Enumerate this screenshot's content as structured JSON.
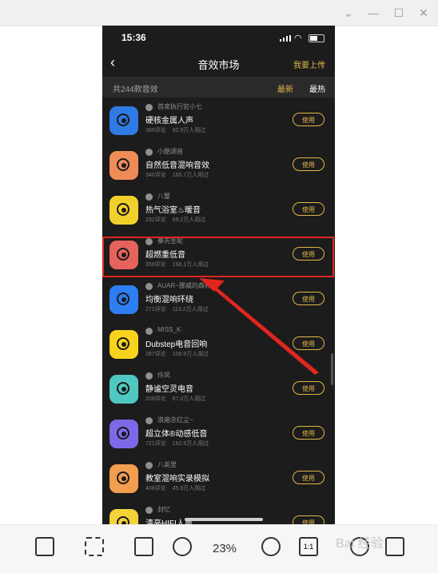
{
  "app": {
    "title": "音效市场",
    "upload_label": "我要上传",
    "time": "15:36"
  },
  "header": {
    "count_text": "共244款音效",
    "sort_new": "最新",
    "sort_hot": "最热"
  },
  "items": [
    {
      "author": "首席执行官小七",
      "name": "硬核金属人声",
      "comments": "369评论",
      "users": "92.9万人用过",
      "use_label": "使用",
      "icon_color": "#2f7ae5"
    },
    {
      "author": "小酷调音",
      "name": "自然低音混响音效",
      "comments": "340评论",
      "users": "166.7万人用过",
      "use_label": "使用",
      "icon_color": "#f08b57"
    },
    {
      "author": "八蟹",
      "name": "热气浴室♨暖音",
      "comments": "232评论",
      "users": "69.2万人用过",
      "use_label": "使用",
      "icon_color": "#f2d02b"
    },
    {
      "author": "秦先生呢",
      "name": "超燃重低音",
      "comments": "359评论",
      "users": "168.1万人用过",
      "use_label": "使用",
      "icon_color": "#e6625d"
    },
    {
      "author": "AUAR~挪威的森林",
      "name": "均衡混响环绕",
      "comments": "271评论",
      "users": "113.2万人用过",
      "use_label": "使用",
      "icon_color": "#2d7ef2"
    },
    {
      "author": "MISS_K",
      "name": "Dubstep电音回响",
      "comments": "287评论",
      "users": "106.9万人用过",
      "use_label": "使用",
      "icon_color": "#f7d31d"
    },
    {
      "author": "伶凤",
      "name": "静谧空灵电音",
      "comments": "209评论",
      "users": "67.0万人用过",
      "use_label": "使用",
      "icon_color": "#4fc8c2"
    },
    {
      "author": "浪遍念红尘~",
      "name": "超立体®动感低音",
      "comments": "721评论",
      "users": "162.6万人用过",
      "use_label": "使用",
      "icon_color": "#7d69e8"
    },
    {
      "author": "八英里",
      "name": "教室混响实录模拟",
      "comments": "408评论",
      "users": "45.6万人用过",
      "use_label": "使用",
      "icon_color": "#f39d4f"
    },
    {
      "author": "封忆",
      "name": "清亮HIFI人声",
      "comments": "",
      "users": "",
      "use_label": "使用",
      "icon_color": "#f4d33a"
    }
  ],
  "viewer": {
    "zoom": "23%",
    "actual_size_label": "1:1"
  },
  "watermark": "Bai 经验",
  "colors": {
    "accent": "#e0b64a",
    "highlight": "#e0261f"
  }
}
